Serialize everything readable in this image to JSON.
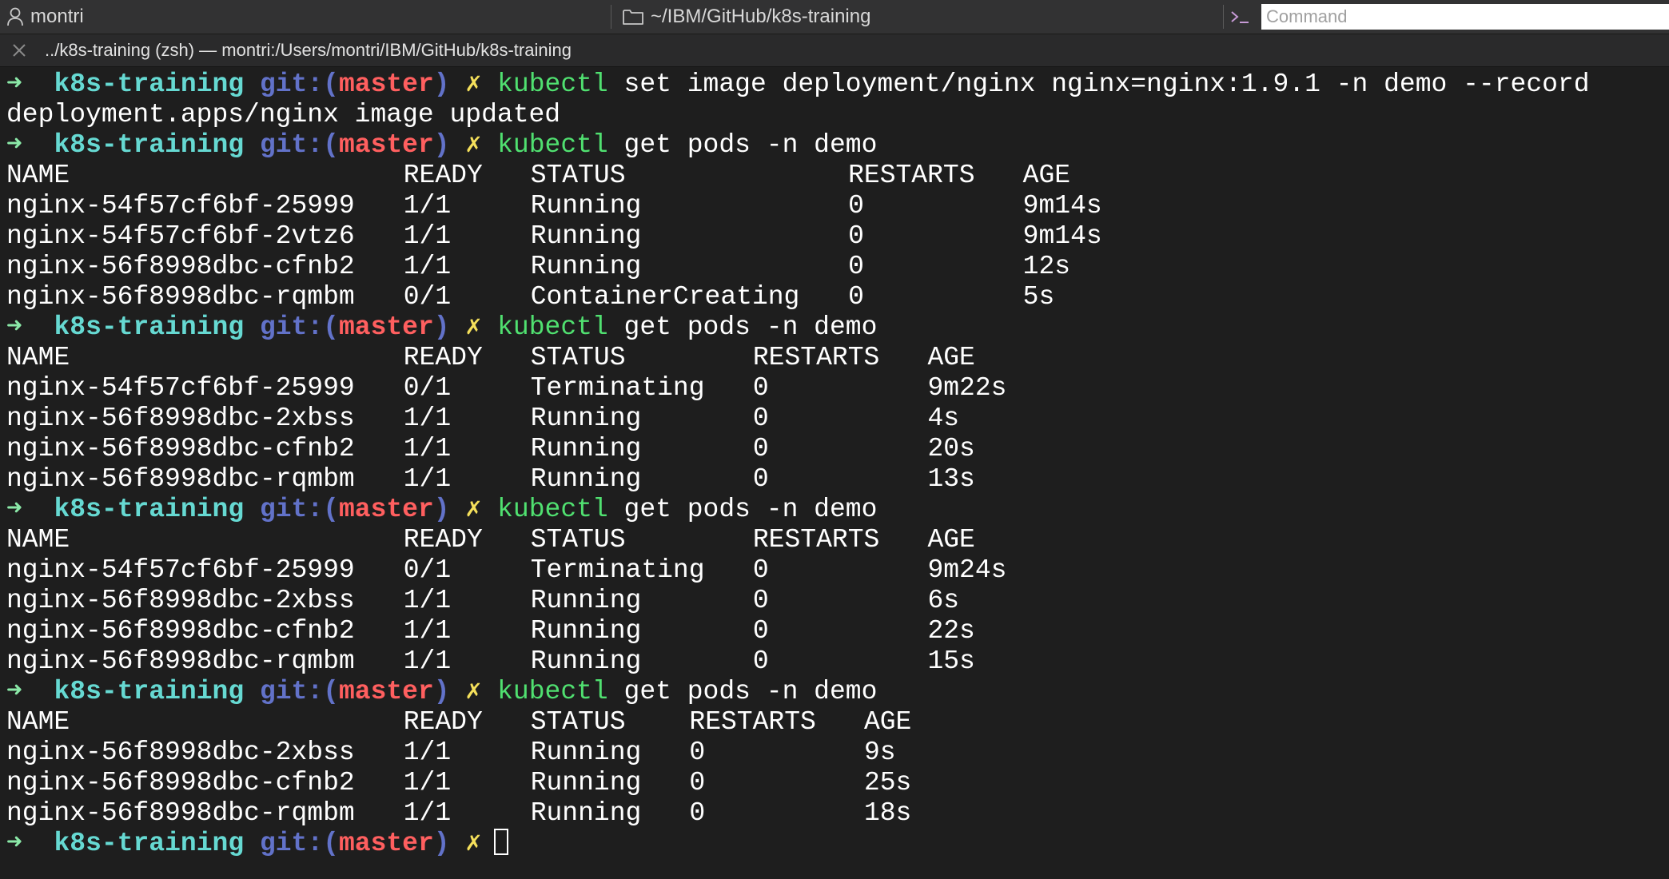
{
  "statusbar": {
    "user": "montri",
    "path": "~/IBM/GitHub/k8s-training",
    "command_placeholder": "Command"
  },
  "tab": {
    "title": "../k8s-training (zsh) — montri:/Users/montri/IBM/GitHub/k8s-training"
  },
  "prompt": {
    "arrow": "➜",
    "dir": "k8s-training",
    "git": "git:(",
    "branch": "master",
    "git_close": ")",
    "dirty": "✗"
  },
  "blocks": [
    {
      "command": "kubectl",
      "args": " set image deployment/nginx nginx=nginx:1.9.1 -n demo --record",
      "output": [
        "deployment.apps/nginx image updated"
      ]
    },
    {
      "command": "kubectl",
      "args": " get pods -n demo",
      "table": {
        "widths": [
          25,
          8,
          20,
          11,
          7
        ],
        "headers": [
          "NAME",
          "READY",
          "STATUS",
          "RESTARTS",
          "AGE"
        ],
        "rows": [
          [
            "nginx-54f57cf6bf-25999",
            "1/1",
            "Running",
            "0",
            "9m14s"
          ],
          [
            "nginx-54f57cf6bf-2vtz6",
            "1/1",
            "Running",
            "0",
            "9m14s"
          ],
          [
            "nginx-56f8998dbc-cfnb2",
            "1/1",
            "Running",
            "0",
            "12s"
          ],
          [
            "nginx-56f8998dbc-rqmbm",
            "0/1",
            "ContainerCreating",
            "0",
            "5s"
          ]
        ]
      }
    },
    {
      "command": "kubectl",
      "args": " get pods -n demo",
      "table": {
        "widths": [
          25,
          8,
          14,
          11,
          7
        ],
        "headers": [
          "NAME",
          "READY",
          "STATUS",
          "RESTARTS",
          "AGE"
        ],
        "rows": [
          [
            "nginx-54f57cf6bf-25999",
            "0/1",
            "Terminating",
            "0",
            "9m22s"
          ],
          [
            "nginx-56f8998dbc-2xbss",
            "1/1",
            "Running",
            "0",
            "4s"
          ],
          [
            "nginx-56f8998dbc-cfnb2",
            "1/1",
            "Running",
            "0",
            "20s"
          ],
          [
            "nginx-56f8998dbc-rqmbm",
            "1/1",
            "Running",
            "0",
            "13s"
          ]
        ]
      }
    },
    {
      "command": "kubectl",
      "args": " get pods -n demo",
      "table": {
        "widths": [
          25,
          8,
          14,
          11,
          7
        ],
        "headers": [
          "NAME",
          "READY",
          "STATUS",
          "RESTARTS",
          "AGE"
        ],
        "rows": [
          [
            "nginx-54f57cf6bf-25999",
            "0/1",
            "Terminating",
            "0",
            "9m24s"
          ],
          [
            "nginx-56f8998dbc-2xbss",
            "1/1",
            "Running",
            "0",
            "6s"
          ],
          [
            "nginx-56f8998dbc-cfnb2",
            "1/1",
            "Running",
            "0",
            "22s"
          ],
          [
            "nginx-56f8998dbc-rqmbm",
            "1/1",
            "Running",
            "0",
            "15s"
          ]
        ]
      }
    },
    {
      "command": "kubectl",
      "args": " get pods -n demo",
      "table": {
        "widths": [
          25,
          8,
          10,
          11,
          7
        ],
        "headers": [
          "NAME",
          "READY",
          "STATUS",
          "RESTARTS",
          "AGE"
        ],
        "rows": [
          [
            "nginx-56f8998dbc-2xbss",
            "1/1",
            "Running",
            "0",
            "9s"
          ],
          [
            "nginx-56f8998dbc-cfnb2",
            "1/1",
            "Running",
            "0",
            "25s"
          ],
          [
            "nginx-56f8998dbc-rqmbm",
            "1/1",
            "Running",
            "0",
            "18s"
          ]
        ]
      }
    }
  ]
}
